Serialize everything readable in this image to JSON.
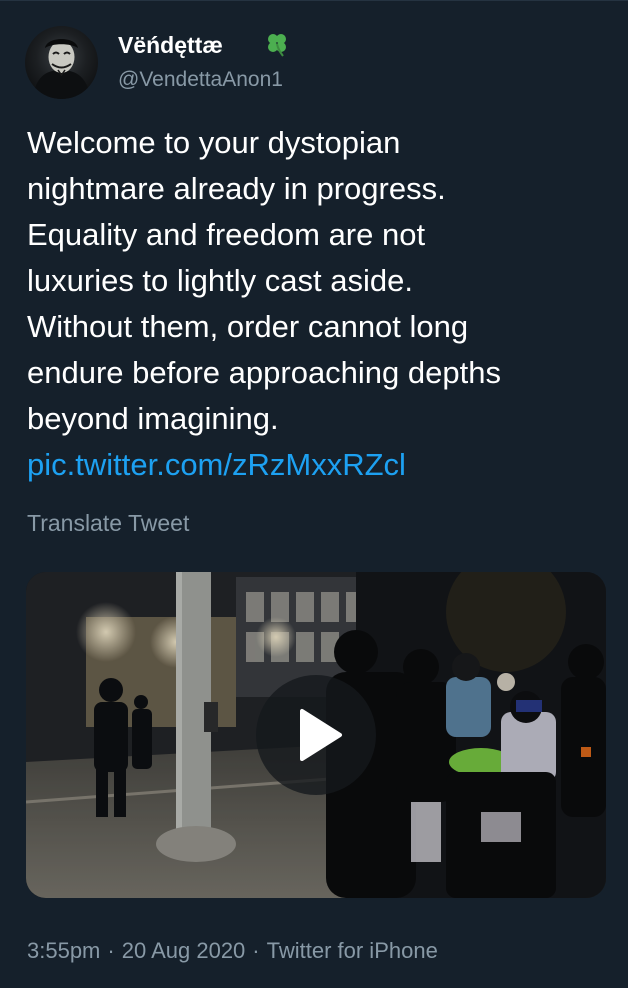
{
  "tweet": {
    "author": {
      "display_name": "Vëńdęttæ",
      "badge_icon": "four-leaf-clover-icon",
      "handle": "@VendettaAnon1"
    },
    "text_lines": [
      "Welcome to your dystopian",
      "nightmare already in progress.",
      "Equality and freedom are not",
      "luxuries to lightly cast aside.",
      "Without them, order cannot long",
      "endure before approaching depths",
      "beyond imagining."
    ],
    "link": "pic.twitter.com/zRzMxxRZcl",
    "translate_label": "Translate Tweet",
    "media": {
      "type": "video",
      "play_icon": "play-icon"
    },
    "meta": {
      "time": "3:55pm",
      "separator": "·",
      "date": "20 Aug 2020",
      "source": "Twitter for iPhone"
    }
  },
  "colors": {
    "background": "#15202b",
    "text": "#ffffff",
    "secondary_text": "#8899a6",
    "link": "#1da1f2",
    "clover": "#4caf50"
  }
}
